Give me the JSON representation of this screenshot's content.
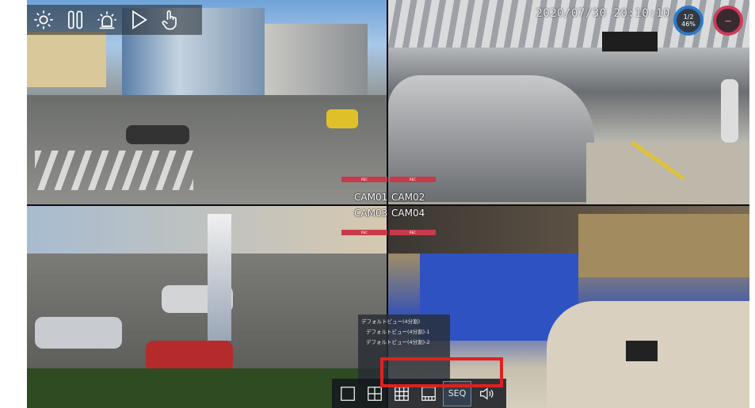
{
  "header": {
    "datetime": "2020/07/30 20:10:10",
    "page_indicator": "1/2",
    "percent": "46%",
    "status_ring_label": "—"
  },
  "toolbar": {
    "icons": [
      "gear-icon",
      "pause-icon",
      "alarm-icon",
      "play-icon",
      "touch-hand-icon"
    ]
  },
  "cameras": [
    {
      "label": "CAM01",
      "rec": "REC"
    },
    {
      "label": "CAM02",
      "rec": "REC"
    },
    {
      "label": "CAM03",
      "rec": "REC"
    },
    {
      "label": "CAM04",
      "rec": "REC"
    }
  ],
  "sequence_panel": {
    "title": "デフォルトビュー(4分割)",
    "items": [
      "デフォルトビュー(4分割)-1",
      "デフォルトビュー(4分割)-2"
    ]
  },
  "bottombar": {
    "icons": [
      "single-view-icon",
      "quad-view-icon",
      "nine-view-icon",
      "sixteen-view-icon"
    ],
    "seq_label": "SEQ",
    "audio_icon": "speaker-icon"
  },
  "colors": {
    "highlight": "#e02020",
    "ring_blue": "#2d78c8",
    "ring_red": "#d03a5a",
    "rec_bar": "#c73a4a"
  }
}
